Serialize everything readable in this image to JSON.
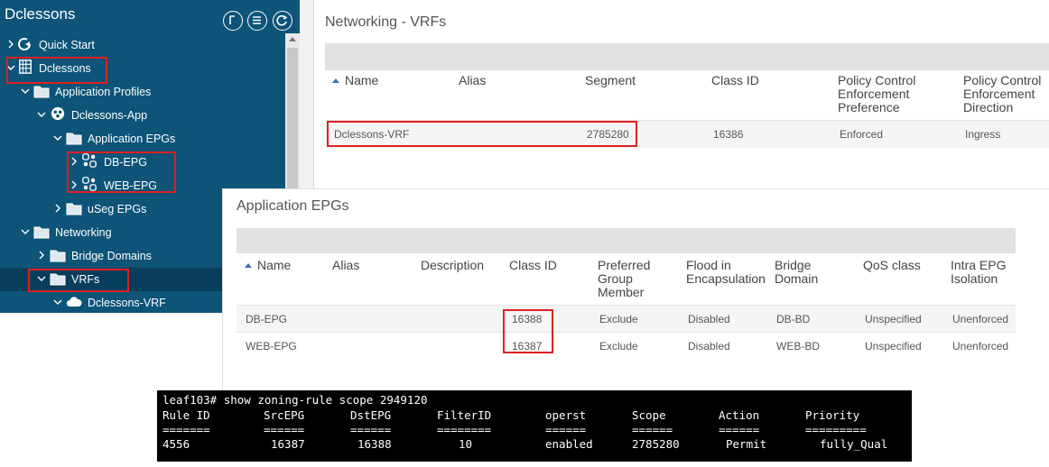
{
  "sidebar": {
    "title": "Dclessons",
    "tree": [
      {
        "label": "Quick Start",
        "icon": "quick-start-icon",
        "expanded": false
      },
      {
        "label": "Dclessons",
        "icon": "tenant-icon",
        "expanded": true
      },
      {
        "label": "Application Profiles",
        "icon": "folder-icon",
        "expanded": true
      },
      {
        "label": "Dclessons-App",
        "icon": "app-profile-icon",
        "expanded": true
      },
      {
        "label": "Application EPGs",
        "icon": "folder-icon",
        "expanded": true
      },
      {
        "label": "DB-EPG",
        "icon": "epg-icon",
        "expanded": false
      },
      {
        "label": "WEB-EPG",
        "icon": "epg-icon",
        "expanded": false
      },
      {
        "label": "uSeg EPGs",
        "icon": "folder-icon",
        "expanded": false
      },
      {
        "label": "Networking",
        "icon": "folder-icon",
        "expanded": true
      },
      {
        "label": "Bridge Domains",
        "icon": "folder-icon",
        "expanded": false
      },
      {
        "label": "VRFs",
        "icon": "folder-icon",
        "expanded": true
      },
      {
        "label": "Dclessons-VRF",
        "icon": "cloud-icon",
        "expanded": true
      }
    ]
  },
  "vrf_panel": {
    "title": "Networking - VRFs",
    "headers": {
      "name": "Name",
      "alias": "Alias",
      "segment": "Segment",
      "class_id": "Class ID",
      "pc_pref": [
        "Policy Control",
        "Enforcement",
        "Preference"
      ],
      "pc_dir": [
        "Policy Control",
        "Enforcement",
        "Direction"
      ]
    },
    "rows": [
      {
        "name": "Dclessons-VRF",
        "alias": "",
        "segment": "2785280",
        "class_id": "16386",
        "pc_pref": "Enforced",
        "pc_dir": "Ingress"
      }
    ]
  },
  "epg_panel": {
    "title": "Application EPGs",
    "headers": {
      "name": "Name",
      "alias": "Alias",
      "description": "Description",
      "class_id": "Class ID",
      "preferred": [
        "Preferred",
        "Group",
        "Member"
      ],
      "flood": [
        "Flood in",
        "Encapsulation"
      ],
      "bd": [
        "Bridge",
        "Domain"
      ],
      "qos": "QoS class",
      "intra": [
        "Intra EPG",
        "Isolation"
      ]
    },
    "rows": [
      {
        "name": "DB-EPG",
        "alias": "",
        "description": "",
        "class_id": "16388",
        "preferred": "Exclude",
        "flood": "Disabled",
        "bd": "DB-BD",
        "qos": "Unspecified",
        "intra": "Unenforced"
      },
      {
        "name": "WEB-EPG",
        "alias": "",
        "description": "",
        "class_id": "16387",
        "preferred": "Exclude",
        "flood": "Disabled",
        "bd": "WEB-BD",
        "qos": "Unspecified",
        "intra": "Unenforced"
      }
    ]
  },
  "terminal": {
    "prompt": "leaf103# show zoning-rule scope 2949120",
    "headers": [
      "Rule ID",
      "SrcEPG",
      "DstEPG",
      "FilterID",
      "operst",
      "Scope",
      "Action",
      "Priority"
    ],
    "separators": [
      "=======",
      "======",
      "======",
      "========",
      "======",
      "======",
      "======",
      "========="
    ],
    "row": [
      "4556",
      "16387",
      "16388",
      "10",
      "enabled",
      "2785280",
      "Permit",
      "fully_Qual"
    ]
  },
  "colors": {
    "sidebar_bg": "#0d5478",
    "highlight_border": "#e02020",
    "terminal_bg": "#000000"
  }
}
